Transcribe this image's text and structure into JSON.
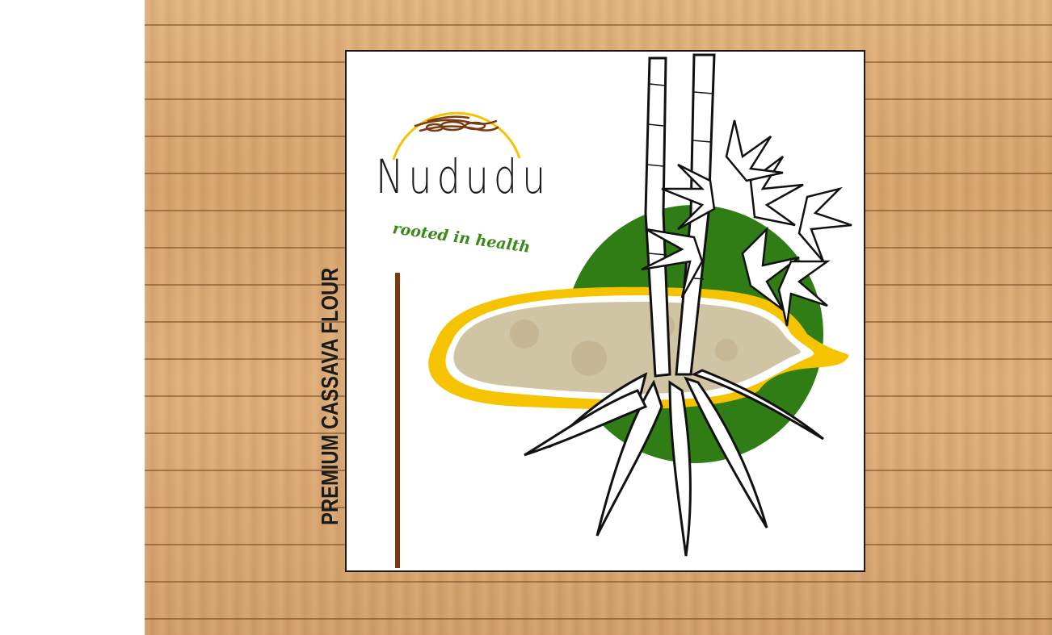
{
  "package": {
    "brand_name": "Nududu",
    "tagline": "rooted in health",
    "product_title": "PREMIUM CASSAVA FLOUR"
  },
  "colors": {
    "wood": "#d9a46a",
    "green_circle": "#2f7d14",
    "yellow_outline": "#f5c300",
    "brown_rule": "#7a3a10",
    "tagline_green": "#3a8a1a",
    "flour": "#cfc4a4"
  },
  "icons": [
    "cassava-roots-logo-icon",
    "cassava-plant-illustration"
  ]
}
